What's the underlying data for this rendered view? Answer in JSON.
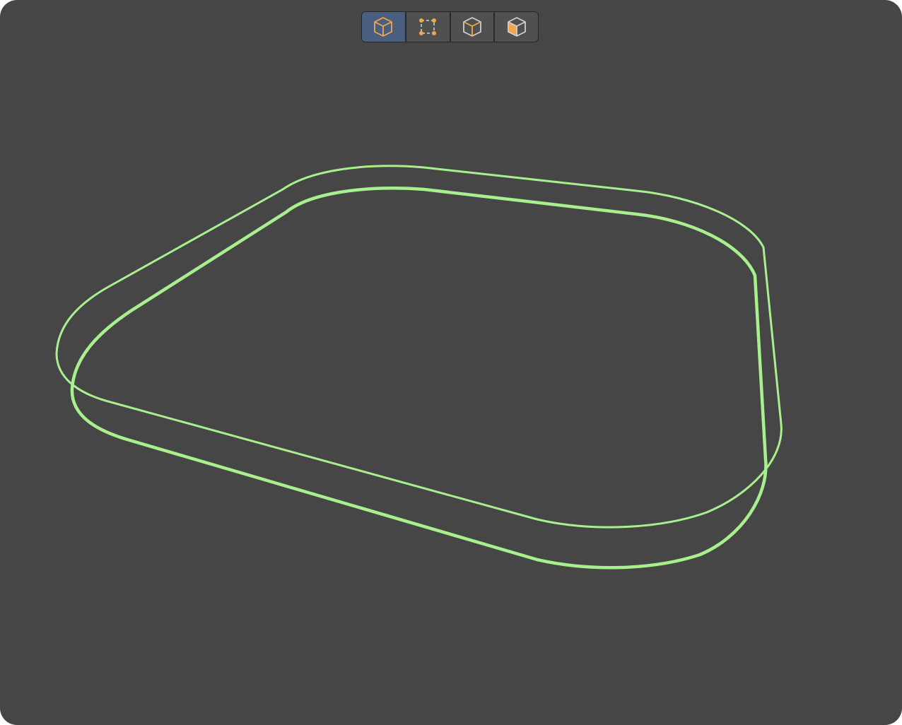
{
  "viewport": {
    "background": "#464646"
  },
  "toolbar": {
    "buttons": [
      {
        "icon": "object-mode-icon",
        "active": true
      },
      {
        "icon": "vertex-mode-icon",
        "active": false
      },
      {
        "icon": "wireframe-cube-icon",
        "active": false
      },
      {
        "icon": "solid-face-cube-icon",
        "active": false
      }
    ],
    "accent_color": "#f0a64a",
    "active_color": "#4a5f80"
  },
  "scene": {
    "outline_color": "#a8f08e",
    "object": "rounded-slab-outline"
  }
}
